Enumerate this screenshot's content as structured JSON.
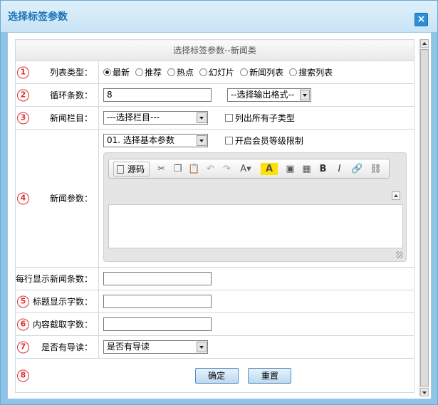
{
  "window": {
    "title": "选择标签参数",
    "close_glyph": "×"
  },
  "form": {
    "header": "选择标签参数--新闻类",
    "rows": {
      "list_type": {
        "number": "1",
        "label": "列表类型：",
        "options": [
          "最新",
          "推荐",
          "热点",
          "幻灯片",
          "新闻列表",
          "搜索列表"
        ],
        "selected": "最新"
      },
      "loop_count": {
        "number": "2",
        "label": "循环条数：",
        "value": "8",
        "format_select": "--选择输出格式--"
      },
      "category": {
        "number": "3",
        "label": "新闻栏目：",
        "select_value": "---选择栏目---",
        "checkbox_label": "列出所有子类型"
      },
      "params": {
        "number": "4",
        "label": "新闻参数：",
        "select_value": "01. 选择基本参数",
        "checkbox_label": "开启会员等级限制",
        "editor_source_label": "源码"
      },
      "per_row": {
        "label": "每行显示新闻条数：",
        "value": ""
      },
      "title_chars": {
        "number": "5",
        "label": "标题显示字数：",
        "value": ""
      },
      "content_chars": {
        "number": "6",
        "label": "内容截取字数：",
        "value": ""
      },
      "has_intro": {
        "number": "7",
        "label": "是否有导读：",
        "select_value": "是否有导读"
      },
      "actions": {
        "number": "8",
        "confirm": "确定",
        "reset": "重置"
      }
    }
  },
  "icons": {
    "source": "document-icon",
    "cut": "scissors-icon",
    "copy": "copy-icon",
    "paste": "paste-icon",
    "undo": "undo-icon",
    "redo": "redo-icon",
    "font_color": "font-color-icon",
    "highlight": "highlight-icon",
    "image": "image-icon",
    "table": "table-icon",
    "bold": "bold-icon",
    "italic": "italic-icon",
    "link": "link-icon",
    "unlink": "unlink-icon"
  },
  "colors": {
    "accent": "#1a73b8",
    "marker": "#e03030",
    "frame": "#8fc4e8"
  }
}
